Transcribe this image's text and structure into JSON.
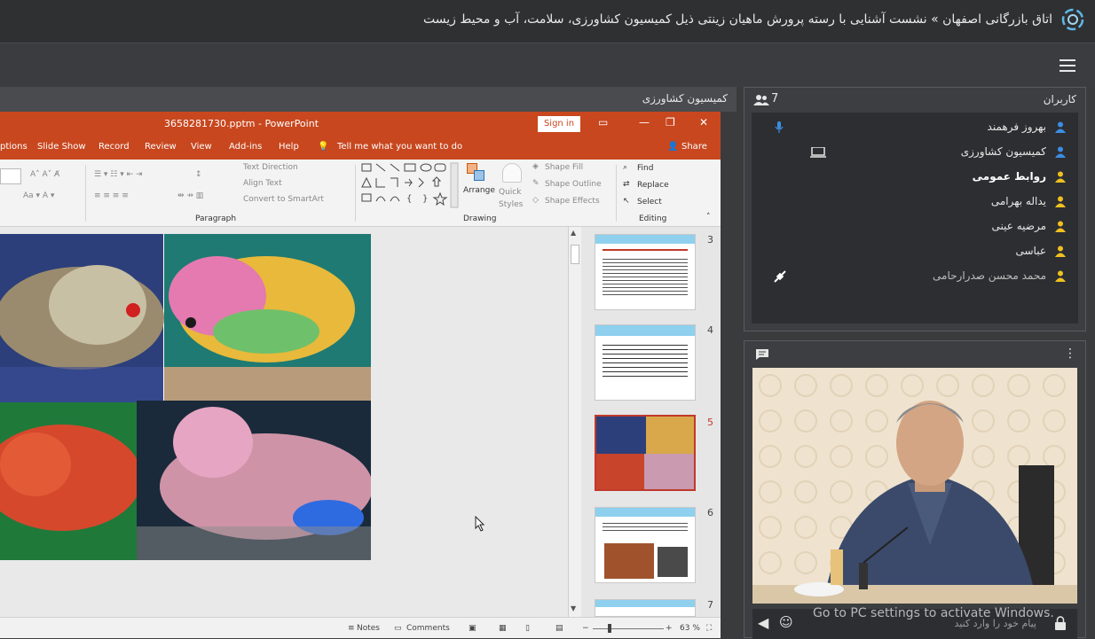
{
  "topbar": {
    "title": "اتاق بازرگانی اصفهان » نشست آشنایی با رسته پرورش ماهیان زینتی ذیل کمیسیون کشاورزی، سلامت، آب و محیط زیست"
  },
  "presentation": {
    "header_label": "کمیسیون کشاورزی",
    "powerpoint": {
      "file_title": "3658281730.pptm  -  PowerPoint",
      "sign_in": "Sign in",
      "menu": [
        "ptions",
        "Slide Show",
        "Record",
        "Review",
        "View",
        "Add-ins",
        "Help",
        "Tell me what you want to do",
        "Share"
      ],
      "ribbon": {
        "text_direction": "Text Direction",
        "align_text": "Align Text",
        "convert_smartart": "Convert to SmartArt",
        "paragraph": "Paragraph",
        "arrange": "Arrange",
        "quick_styles": "Quick Styles",
        "shape_fill": "Shape Fill",
        "shape_outline": "Shape Outline",
        "shape_effects": "Shape Effects",
        "drawing": "Drawing",
        "find": "Find",
        "replace": "Replace",
        "select": "Select",
        "editing": "Editing"
      },
      "thumbnail_numbers": [
        "3",
        "4",
        "5",
        "6",
        "7"
      ],
      "selected_slide": "5",
      "status": {
        "notes": "Notes",
        "comments": "Comments",
        "zoom": "63 %"
      }
    }
  },
  "users": {
    "title": "کاربران",
    "count": "7",
    "list": [
      {
        "name": "بهروز فرهمند",
        "color": "#3a8ee6",
        "style": "normal"
      },
      {
        "name": "کمیسیون کشاورزی",
        "color": "#3a8ee6",
        "style": "normal"
      },
      {
        "name": "روابط عمومی",
        "color": "#f0c020",
        "style": "bold"
      },
      {
        "name": "یداله بهرامی",
        "color": "#f0c020",
        "style": "normal"
      },
      {
        "name": "مرضیه عینی",
        "color": "#f0c020",
        "style": "normal"
      },
      {
        "name": "عباسی",
        "color": "#f0c020",
        "style": "normal"
      },
      {
        "name": "محمد محسن صدرارحامی",
        "color": "#f0c020",
        "style": "dim"
      }
    ]
  },
  "chat": {
    "placeholder": "پیام خود را وارد کنید"
  },
  "watermark": "Go to PC settings to activate Windows.",
  "colors": {
    "powerpoint_accent": "#c8471f",
    "mic_active": "#3a8ee6",
    "slide_selected": "#c0392b"
  }
}
